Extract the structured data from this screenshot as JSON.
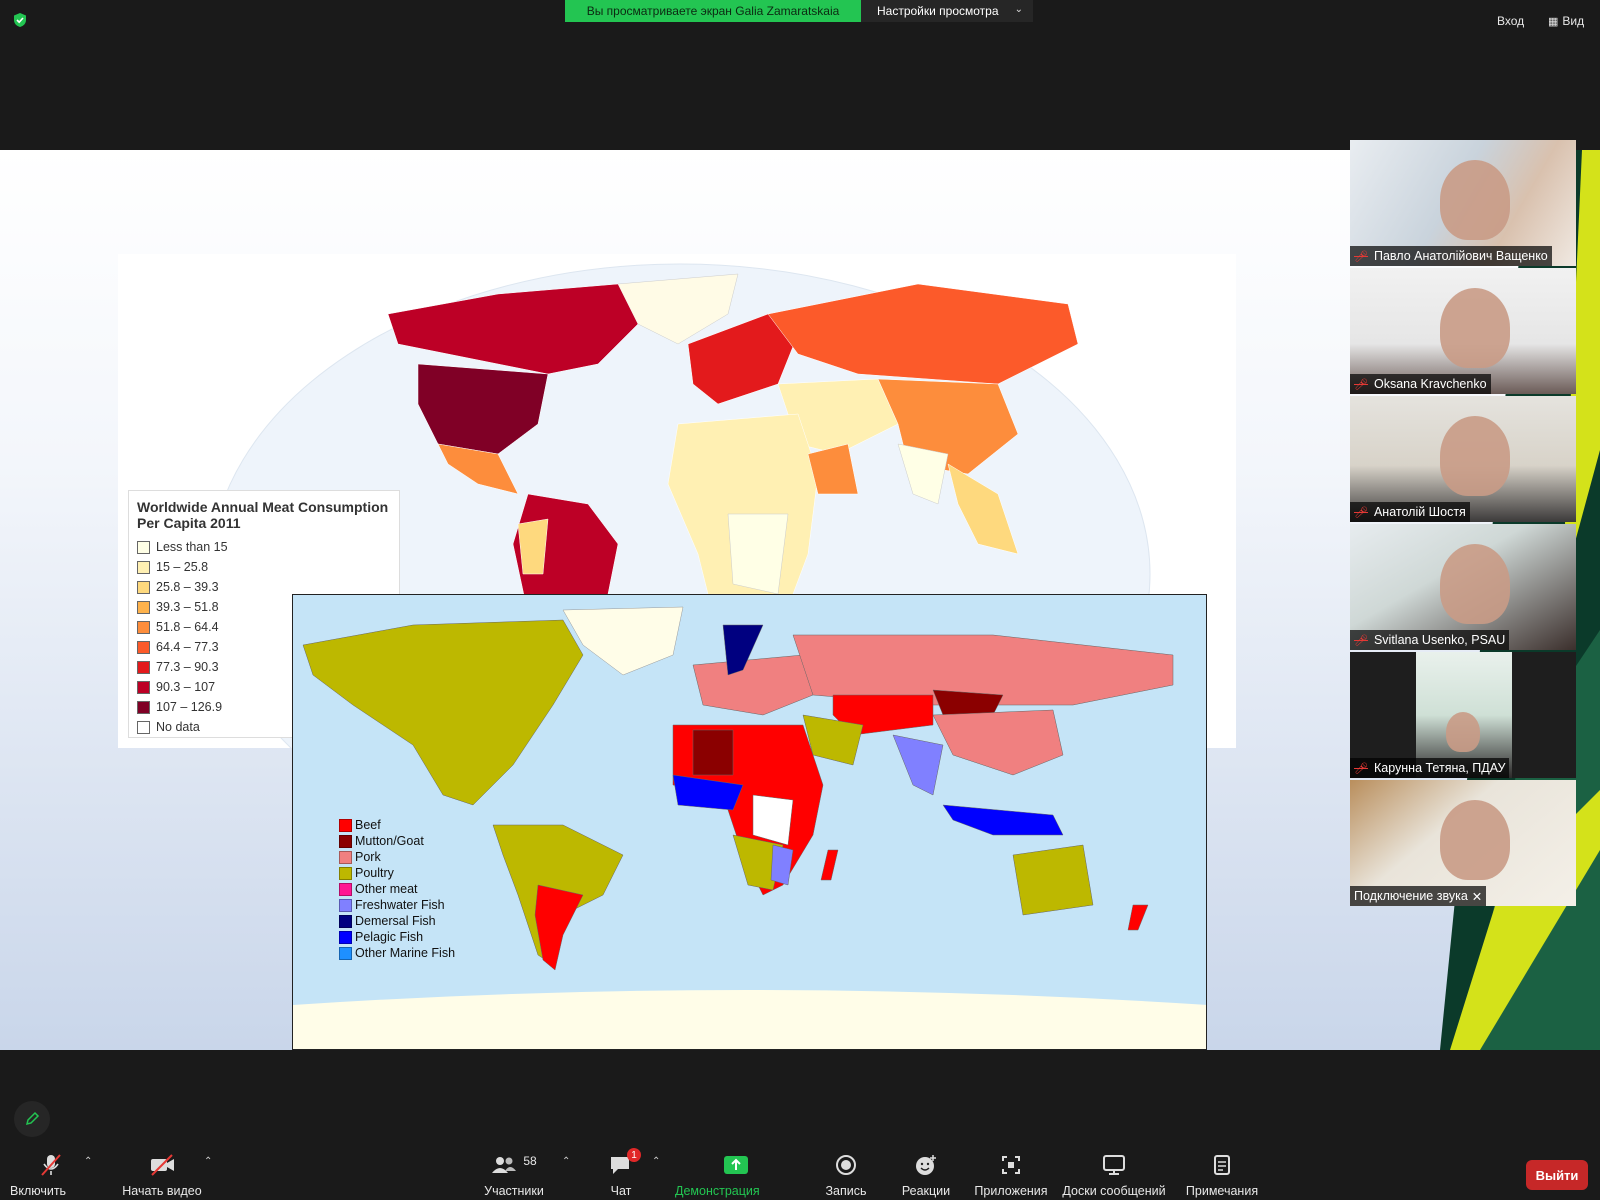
{
  "top": {
    "share_banner": "Вы просматриваете экран Galia Zamaratskaia",
    "view_settings": "Настройки просмотра",
    "enter": "Вход",
    "view": "Вид"
  },
  "map1": {
    "legend_title": "Worldwide Annual Meat Consumption Per Capita 2011",
    "legend": [
      {
        "label": "Less than 15",
        "color": "#ffffe6"
      },
      {
        "label": "15 – 25.8",
        "color": "#fff0b3"
      },
      {
        "label": "25.8 – 39.3",
        "color": "#fed97e"
      },
      {
        "label": "39.3 – 51.8",
        "color": "#feb24c"
      },
      {
        "label": "51.8 – 64.4",
        "color": "#fd8d3c"
      },
      {
        "label": "64.4 – 77.3",
        "color": "#fc5a2a"
      },
      {
        "label": "77.3 – 90.3",
        "color": "#e31a1c"
      },
      {
        "label": "90.3 – 107",
        "color": "#bd0026"
      },
      {
        "label": "107 – 126.9",
        "color": "#800026"
      },
      {
        "label": "No data",
        "color": "#ffffff"
      }
    ]
  },
  "map2": {
    "legend": [
      {
        "label": "Beef",
        "color": "#ff0000"
      },
      {
        "label": "Mutton/Goat",
        "color": "#8b0000"
      },
      {
        "label": "Pork",
        "color": "#f08080"
      },
      {
        "label": "Poultry",
        "color": "#bdb800"
      },
      {
        "label": "Other meat",
        "color": "#ff1493"
      },
      {
        "label": "Freshwater Fish",
        "color": "#8080ff"
      },
      {
        "label": "Demersal Fish",
        "color": "#000080"
      },
      {
        "label": "Pelagic Fish",
        "color": "#0000ff"
      },
      {
        "label": "Other Marine Fish",
        "color": "#1e90ff"
      }
    ]
  },
  "participants": [
    {
      "name": "Павло Анатолійович Ващенко",
      "muted": true
    },
    {
      "name": "Oksana Kravchenko",
      "muted": true
    },
    {
      "name": "Анатолій Шостя",
      "muted": true
    },
    {
      "name": "Svitlana Usenko, PSAU",
      "muted": true
    },
    {
      "name": "Карунна Тетяна, ПДАУ",
      "muted": true
    },
    {
      "name": "Подключение звука",
      "muted": false
    }
  ],
  "toolbar": {
    "unmute": "Включить звук",
    "start_video": "Начать видео",
    "participants": "Участники",
    "participants_count": "58",
    "chat": "Чат",
    "chat_badge": "1",
    "share": "Демонстрация экрана",
    "record": "Запись",
    "reactions": "Реакции",
    "apps": "Приложения",
    "whiteboards": "Доски сообщений",
    "notes": "Примечания",
    "leave": "Выйти"
  }
}
